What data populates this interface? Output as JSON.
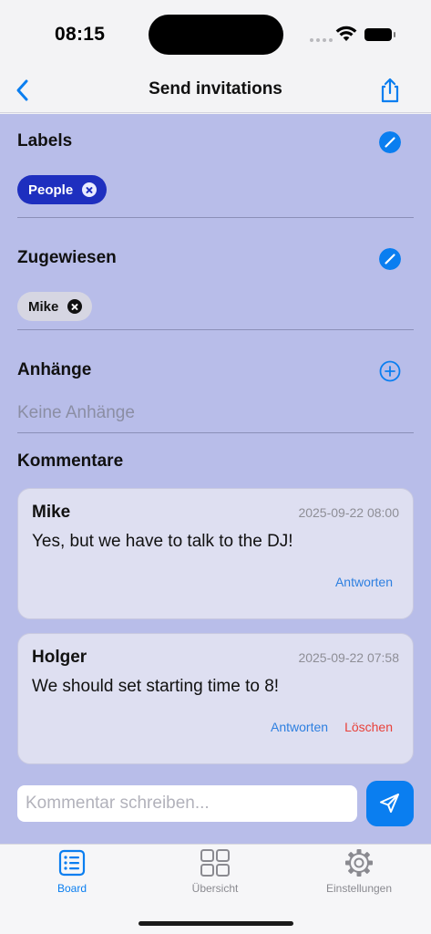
{
  "status_bar": {
    "time": "08:15"
  },
  "nav": {
    "title": "Send invitations",
    "back_icon": "chevron-left-icon",
    "share_icon": "share-icon"
  },
  "colors": {
    "accent": "#0a7ef0",
    "label_chip": "#1e2fbf",
    "content_bg": "#b8bde9",
    "delete": "#e8413a"
  },
  "labels_section": {
    "title": "Labels",
    "edit_icon": "pencil-circle-icon",
    "chips": [
      "People"
    ]
  },
  "assigned_section": {
    "title": "Zugewiesen",
    "edit_icon": "pencil-circle-icon",
    "chips": [
      "Mike"
    ]
  },
  "attachments_section": {
    "title": "Anhänge",
    "add_icon": "plus-circle-icon",
    "empty_text": "Keine Anhänge"
  },
  "comments_section": {
    "title": "Kommentare",
    "comments": [
      {
        "author": "Mike",
        "date": "2025-09-22 08:00",
        "text": "Yes, but we have to talk to the DJ!",
        "reply_label": "Antworten"
      },
      {
        "author": "Holger",
        "date": "2025-09-22 07:58",
        "text": "We should set starting time to 8!",
        "reply_label": "Antworten",
        "delete_label": "Löschen"
      }
    ],
    "input_placeholder": "Kommentar schreiben...",
    "send_icon": "paperplane-icon"
  },
  "tab_bar": {
    "tabs": [
      {
        "label": "Board",
        "icon": "list-icon",
        "active": true
      },
      {
        "label": "Übersicht",
        "icon": "grid-icon",
        "active": false
      },
      {
        "label": "Einstellungen",
        "icon": "gear-icon",
        "active": false
      }
    ]
  }
}
